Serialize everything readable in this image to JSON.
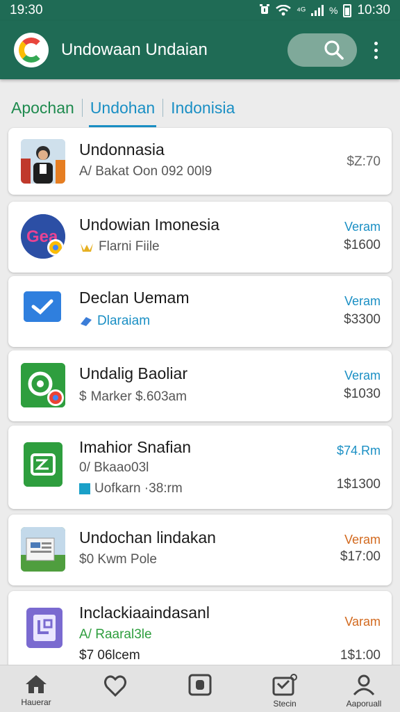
{
  "status_bar": {
    "time": "19:30",
    "clock": "10:30"
  },
  "app_bar": {
    "title": "Undowaan Undaian",
    "search_icon": "search-icon",
    "menu_icon": "more-vert-icon"
  },
  "tabs": [
    {
      "label": "Apochan"
    },
    {
      "label": "Undohan"
    },
    {
      "label": "Indonisia"
    }
  ],
  "list": [
    {
      "title": "Undonnasia",
      "subtitle": "A/ Bakat Oon 092 00l9",
      "price": "$Z:70"
    },
    {
      "title": "Undowian Imonesia",
      "subtitle": "Flarni Fiile",
      "tag": "Veram",
      "price": "$1600"
    },
    {
      "title": "Declan Uemam",
      "subtitle": "Dlaraiam",
      "tag": "Veram",
      "price": "$3300"
    },
    {
      "title": "Undalig Baoliar",
      "subtitle": "Marker $.603am",
      "tag": "Veram",
      "price": "$1030"
    },
    {
      "title": "Imahior Snafian",
      "subtitle": "0/ Bkaao03l",
      "subtitle2": "Uofkarn ·38:rm",
      "tag": "$74.Rm",
      "price": "1$1300"
    },
    {
      "title": "Undochan lindakan",
      "subtitle": "$0 Kwm Pole",
      "tag": "Veram",
      "price": "$17:00"
    },
    {
      "title": "Inclackiaaindasanl",
      "subtitle": "A/ Raaral3le",
      "subtitle2": "$7 06lcem",
      "tag": "Varam",
      "price": "1$1:00"
    }
  ],
  "bottom_nav": [
    {
      "label": "Hauerar",
      "icon": "home-icon"
    },
    {
      "label": "",
      "icon": "heart-icon"
    },
    {
      "label": "",
      "icon": "camera-icon"
    },
    {
      "label": "Stecin",
      "icon": "inbox-icon"
    },
    {
      "label": "Aaporuall",
      "icon": "profile-icon"
    }
  ],
  "colors": {
    "header": "#1f6b55",
    "tab_green": "#1e8a4e",
    "accent_blue": "#1a8fc4",
    "tag_blue": "#1a8fc4",
    "tag_orange": "#d2691e"
  }
}
